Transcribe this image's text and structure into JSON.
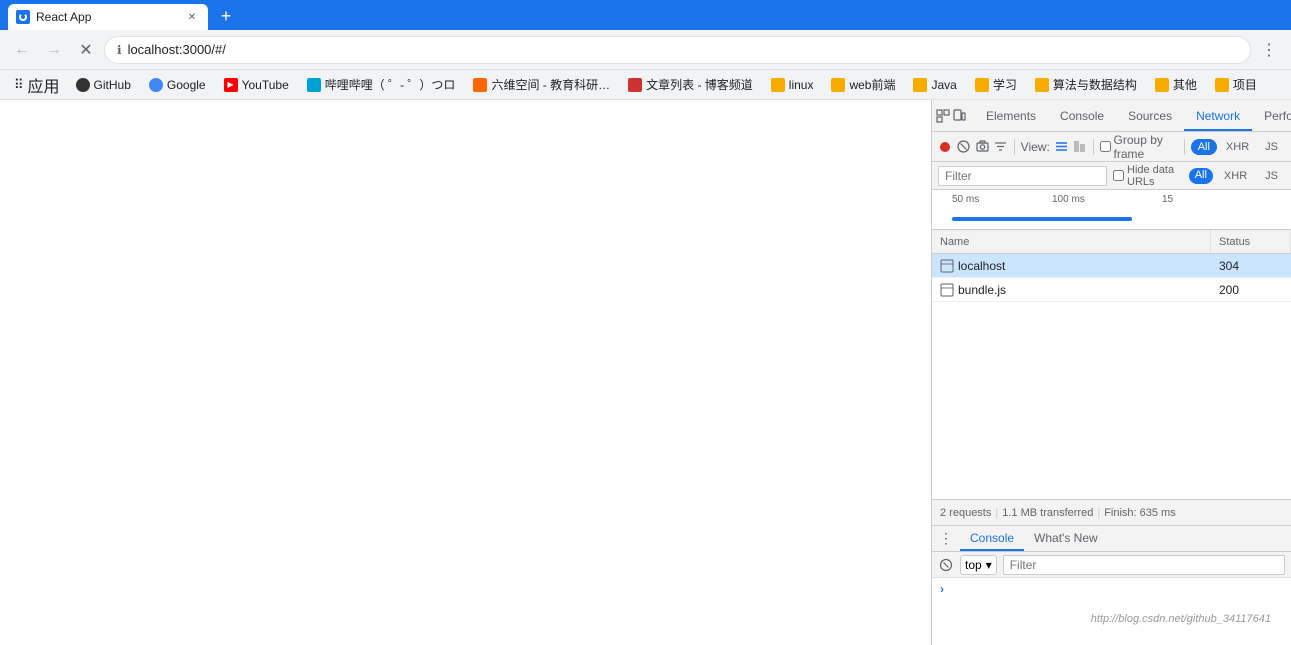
{
  "browser": {
    "tab": {
      "title": "React App",
      "loading": true
    },
    "addressBar": {
      "url": "localhost:3000/#/",
      "secure": false
    }
  },
  "bookmarks": {
    "apps_label": "应用",
    "items": [
      {
        "label": "GitHub",
        "color": "bk-github"
      },
      {
        "label": "Google",
        "color": "bk-google-g"
      },
      {
        "label": "YouTube",
        "color": "bk-yt"
      },
      {
        "label": "哔哩哔哩（ ゜- ゜）つロ",
        "color": "bk-bili"
      },
      {
        "label": "六维空间 - 教育科研…",
        "color": "bk-66"
      },
      {
        "label": "文章列表 - 博客频道",
        "color": "bk-csdn"
      },
      {
        "label": "linux",
        "folder": true
      },
      {
        "label": "web前端",
        "folder": true
      },
      {
        "label": "Java",
        "folder": true
      },
      {
        "label": "学习",
        "folder": true
      },
      {
        "label": "算法与数据结构",
        "folder": true
      },
      {
        "label": "其他",
        "folder": true
      },
      {
        "label": "项目",
        "folder": true
      }
    ]
  },
  "devtools": {
    "tabs": [
      {
        "label": "Elements"
      },
      {
        "label": "Console"
      },
      {
        "label": "Sources"
      },
      {
        "label": "Network",
        "active": true
      },
      {
        "label": "Perfo"
      }
    ],
    "network": {
      "toolbar": {
        "record_title": "Record network log",
        "clear_title": "Clear",
        "filter_title": "Filter",
        "view_label": "View:",
        "group_by_frame": "Group by frame",
        "hide_data_urls": "Hide data URLs",
        "pills": [
          {
            "label": "All",
            "active": true
          },
          {
            "label": "XHR"
          },
          {
            "label": "JS"
          }
        ]
      },
      "filter_placeholder": "Filter",
      "timeline": {
        "markers": [
          "50 ms",
          "100 ms",
          "15"
        ]
      },
      "columns": [
        {
          "label": "Name"
        },
        {
          "label": "Status"
        }
      ],
      "rows": [
        {
          "name": "localhost",
          "status": "304",
          "selected": true
        },
        {
          "name": "bundle.js",
          "status": "200",
          "selected": false
        }
      ],
      "status_bar": {
        "requests": "2 requests",
        "transferred": "1.1 MB transferred",
        "finish": "Finish: 635 ms"
      }
    },
    "console": {
      "tabs": [
        {
          "label": "Console",
          "active": true
        },
        {
          "label": "What's New"
        }
      ],
      "context": "top",
      "filter_placeholder": "Filter",
      "prompt": ">"
    }
  },
  "watermark": "http://blog.csdn.net/github_34117641"
}
